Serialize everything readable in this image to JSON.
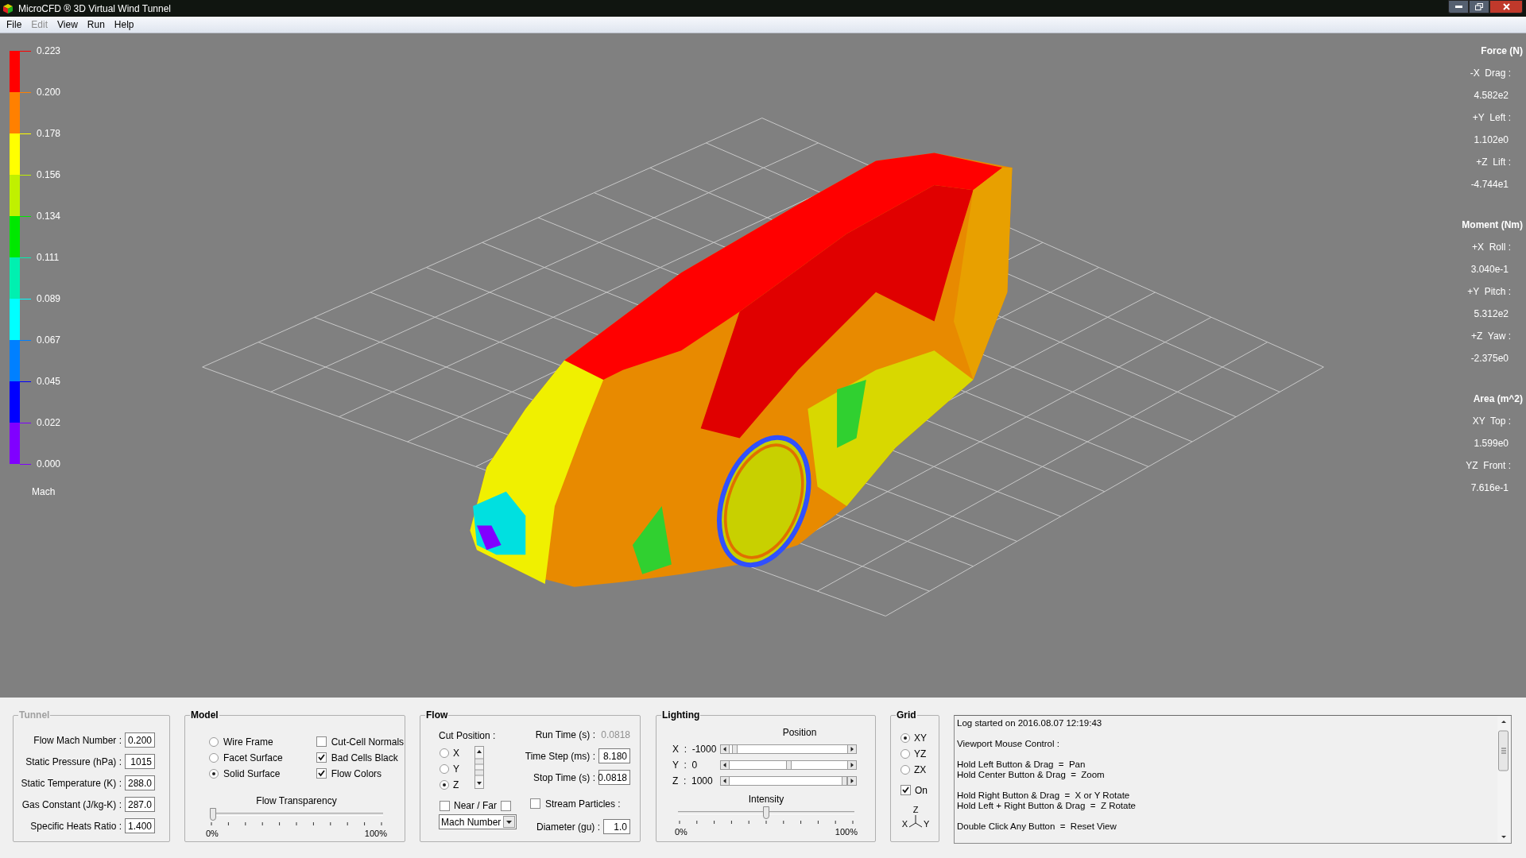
{
  "window": {
    "title": "MicroCFD ® 3D Virtual Wind Tunnel"
  },
  "menu": [
    {
      "label": "File",
      "disabled": false
    },
    {
      "label": "Edit",
      "disabled": true
    },
    {
      "label": "View",
      "disabled": false
    },
    {
      "label": "Run",
      "disabled": false
    },
    {
      "label": "Help",
      "disabled": false
    }
  ],
  "legend": {
    "ticks": [
      "0.223",
      "0.200",
      "0.178",
      "0.156",
      "0.134",
      "0.111",
      "0.089",
      "0.067",
      "0.045",
      "0.022",
      "0.000"
    ],
    "bands": [
      {
        "color": "#ff0000"
      },
      {
        "color": "#ff8000"
      },
      {
        "color": "#ffff00"
      },
      {
        "color": "#c0f000"
      },
      {
        "color": "#00e800"
      },
      {
        "color": "#00f0b0"
      },
      {
        "color": "#00ffff"
      },
      {
        "color": "#0080ff"
      },
      {
        "color": "#0000ff"
      },
      {
        "color": "#8000ff"
      }
    ],
    "unit": "Mach"
  },
  "results": [
    {
      "title": "Force (N)",
      "items": [
        {
          "label": "-X  Drag :",
          "value": "4.582e2"
        },
        {
          "label": "+Y  Left :",
          "value": "1.102e0"
        },
        {
          "label": "+Z  Lift :",
          "value": "-4.744e1"
        }
      ]
    },
    {
      "title": "Moment (Nm)",
      "items": [
        {
          "label": "+X  Roll :",
          "value": "3.040e-1"
        },
        {
          "label": "+Y  Pitch :",
          "value": "5.312e2"
        },
        {
          "label": "+Z  Yaw :",
          "value": "-2.375e0"
        }
      ]
    },
    {
      "title": "Area (m^2)",
      "items": [
        {
          "label": "XY  Top :",
          "value": "1.599e0"
        },
        {
          "label": "YZ  Front :",
          "value": "7.616e-1"
        }
      ]
    }
  ],
  "tunnel": {
    "title": "Tunnel",
    "disabled": true,
    "fields": [
      {
        "label": "Flow Mach Number :",
        "value": "0.200"
      },
      {
        "label": "Static Pressure (hPa) :",
        "value": "1015"
      },
      {
        "label": "Static Temperature (K) :",
        "value": "288.0"
      },
      {
        "label": "Gas Constant (J/kg-K) :",
        "value": "287.0"
      },
      {
        "label": "Specific Heats Ratio :",
        "value": "1.400"
      }
    ]
  },
  "model": {
    "title": "Model",
    "display": [
      {
        "label": "Wire Frame",
        "selected": false
      },
      {
        "label": "Facet Surface",
        "selected": false
      },
      {
        "label": "Solid Surface",
        "selected": true
      }
    ],
    "options": [
      {
        "label": "Cut-Cell Normals",
        "checked": false
      },
      {
        "label": "Bad Cells Black",
        "checked": true
      },
      {
        "label": "Flow Colors",
        "checked": true
      }
    ],
    "transparency": {
      "label": "Flow Transparency",
      "level": 0,
      "min": "0%",
      "max": "100%"
    }
  },
  "flow": {
    "title": "Flow",
    "cut_label": "Cut Position :",
    "cut_axes": [
      {
        "label": "X",
        "selected": false
      },
      {
        "label": "Y",
        "selected": false
      },
      {
        "label": "Z",
        "selected": true
      }
    ],
    "near": {
      "label": "Near / Far",
      "checked": false
    },
    "far": {
      "checked": false
    },
    "variable": "Mach Number",
    "run_time": {
      "label": "Run Time (s) :",
      "value": "0.0818"
    },
    "fields": [
      {
        "label": "Time Step (ms) :",
        "value": "8.180"
      },
      {
        "label": "Stop Time (s) :",
        "value": "0.0818"
      }
    ],
    "stream_particles": {
      "label": "Stream Particles :",
      "checked": false
    },
    "diameter": {
      "label": "Diameter (gu) :",
      "value": "1.0"
    }
  },
  "lighting": {
    "title": "Lighting",
    "position_label": "Position",
    "axes": [
      {
        "label": "X  :  -1000",
        "level": 0.02
      },
      {
        "label": "Y  :  0",
        "level": 0.5
      },
      {
        "label": "Z  :  1000",
        "level": 1
      }
    ],
    "intensity": {
      "label": "Intensity",
      "level": 0.5,
      "min": "0%",
      "max": "100%"
    }
  },
  "grid": {
    "title": "Grid",
    "planes": [
      {
        "label": "XY",
        "selected": true
      },
      {
        "label": "YZ",
        "selected": false
      },
      {
        "label": "ZX",
        "selected": false
      }
    ],
    "on": {
      "label": "On",
      "checked": true
    },
    "axes": [
      "Z",
      "X",
      "Y"
    ]
  },
  "log": {
    "paragraphs": [
      [
        "Log started on 2016.08.07 12:19:43"
      ],
      [
        "Viewport Mouse Control :"
      ],
      [
        "Hold Left Button & Drag  =  Pan",
        "Hold Center Button & Drag  =  Zoom"
      ],
      [
        "Hold Right Button & Drag  =  X or Y Rotate",
        "Hold Left + Right Button & Drag  =  Z Rotate"
      ],
      [
        "Double Click Any Button  =  Reset View"
      ]
    ]
  }
}
